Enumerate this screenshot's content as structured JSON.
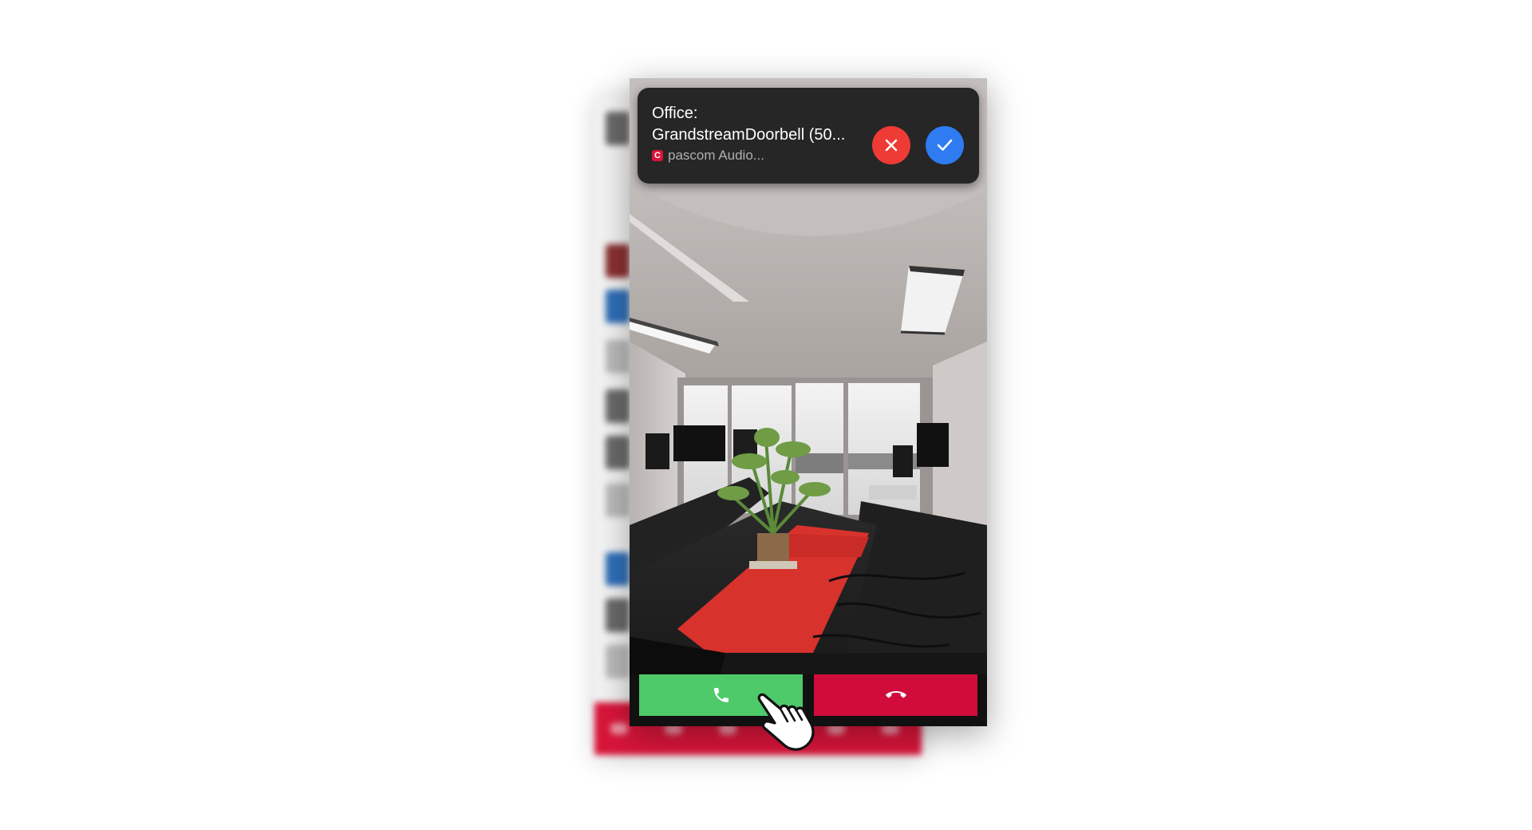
{
  "notification": {
    "title": "Office:\nGrandstreamDoorbell (50...",
    "app_name": "pascom Audio...",
    "app_badge_letter": "C",
    "decline_icon": "close-icon",
    "accept_icon": "check-icon"
  },
  "call_controls": {
    "answer_icon": "phone-icon",
    "hangup_icon": "hangup-icon"
  },
  "colors": {
    "answer": "#4fca6a",
    "hangup": "#d10c3a",
    "decline_round": "#ef3b36",
    "accept_round": "#2f7bf2",
    "brand": "#d9153a"
  }
}
